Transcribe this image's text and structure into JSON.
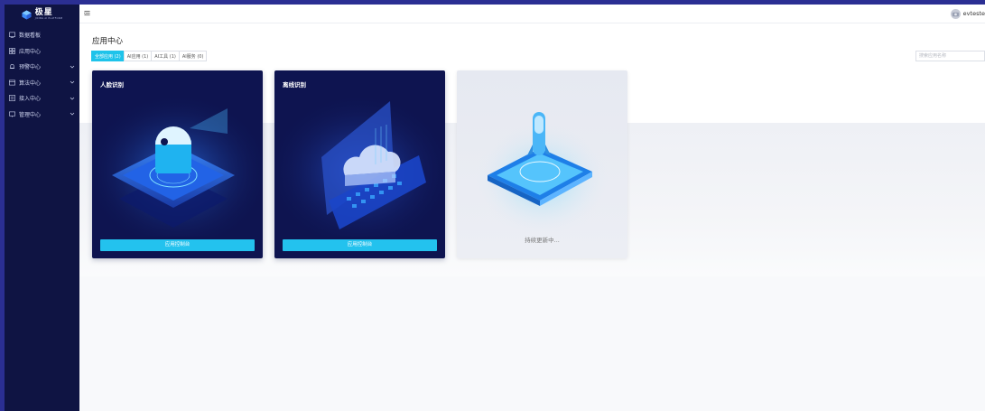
{
  "brand": {
    "title": "极星",
    "subtitle": "JIXING AI PLATFORM"
  },
  "sidebar": {
    "items": [
      {
        "label": "数据看板",
        "icon": "dashboard-icon",
        "expandable": false
      },
      {
        "label": "应用中心",
        "icon": "app-grid-icon",
        "expandable": false
      },
      {
        "label": "预警中心",
        "icon": "alert-icon",
        "expandable": true
      },
      {
        "label": "算法中心",
        "icon": "algorithm-icon",
        "expandable": true
      },
      {
        "label": "接入中心",
        "icon": "access-icon",
        "expandable": true
      },
      {
        "label": "管理中心",
        "icon": "manage-icon",
        "expandable": true
      }
    ]
  },
  "topbar": {
    "username": "evteste"
  },
  "page": {
    "title": "应用中心",
    "tabs": [
      {
        "label": "全部应用 (2)",
        "active": true
      },
      {
        "label": "AI应用 (1)",
        "active": false
      },
      {
        "label": "AI工具 (1)",
        "active": false
      },
      {
        "label": "AI服务 (0)",
        "active": false
      }
    ],
    "search_placeholder": "搜索应用名称"
  },
  "cards": [
    {
      "title": "人脸识别",
      "button": "应用控制台"
    },
    {
      "title": "离线识别",
      "button": "应用控制台"
    },
    {
      "title": "",
      "status": "持续更新中..."
    }
  ],
  "colors": {
    "sidebar": "#0f1443",
    "accent": "#1ec3ea",
    "frame": "#2b2f93"
  }
}
